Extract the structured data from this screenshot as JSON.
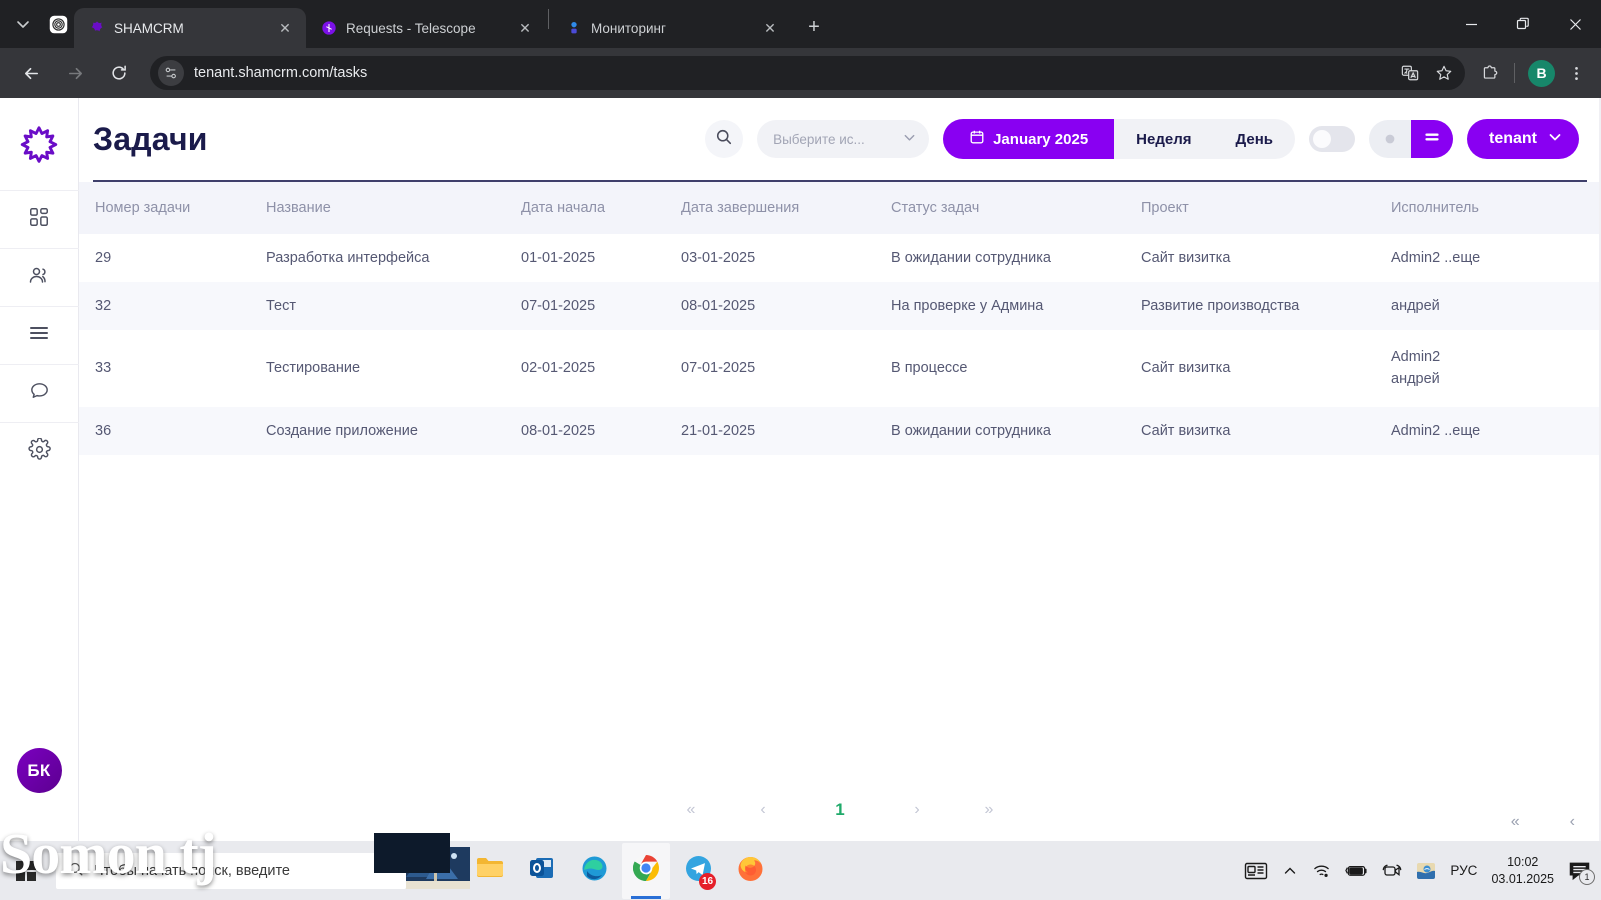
{
  "browser": {
    "tabs": [
      {
        "title": "SHAMCRM",
        "favicon": "shamcrm-icon",
        "active": true
      },
      {
        "title": "Requests - Telescope",
        "favicon": "telescope-icon",
        "active": false
      },
      {
        "title": "Мониторинг",
        "favicon": "monitoring-icon",
        "active": false
      }
    ],
    "new_tab_label": "+",
    "window_controls": {
      "minimize": "−",
      "maximize": "❐",
      "close": "✕"
    },
    "toolbar": {
      "back": "back-arrow",
      "forward": "forward-arrow",
      "reload": "reload",
      "url": "tenant.shamcrm.com/tasks",
      "site_icon": "site-settings-icon",
      "translate": "translate-icon",
      "bookmark": "star-icon",
      "extensions": "extensions-icon",
      "profile_initial": "B",
      "menu": "kebab-menu"
    }
  },
  "app": {
    "sidebar": {
      "logo": "shamcrm-logo",
      "items": [
        {
          "name": "dashboard",
          "icon": "grid-icon"
        },
        {
          "name": "clients",
          "icon": "users-icon"
        },
        {
          "name": "tasks",
          "icon": "menu-lines-icon"
        },
        {
          "name": "chat",
          "icon": "chat-bubble-icon"
        },
        {
          "name": "settings",
          "icon": "gear-icon"
        }
      ],
      "user_initials": "БК"
    },
    "header": {
      "title": "Задачи",
      "search_icon": "search-icon",
      "select_placeholder": "Выберите ис...",
      "select_chevron": "chevron-down-icon",
      "month_label": "January 2025",
      "calendar_icon": "calendar-icon",
      "week_label": "Неделя",
      "day_label": "День",
      "toggle_state": "off",
      "view_icon": "list-view-icon",
      "tenant_label": "tenant",
      "tenant_chevron": "chevron-down-icon",
      "accent_color": "#8900f2",
      "title_color": "#1b1b4b"
    },
    "table": {
      "columns": [
        "Номер задачи",
        "Название",
        "Дата начала",
        "Дата завершения",
        "Статус задач",
        "Проект",
        "Исполнитель"
      ],
      "rows": [
        {
          "number": "29",
          "name": "Разработка интерфейса",
          "start": "01-01-2025",
          "end": "03-01-2025",
          "status": "В ожидании сотрудника",
          "project": "Сайт визитка",
          "assignee": "Admin2 ..еще"
        },
        {
          "number": "32",
          "name": "Тест",
          "start": "07-01-2025",
          "end": "08-01-2025",
          "status": "На проверке у Админа",
          "project": "Развитие производства",
          "assignee": "андрей"
        },
        {
          "number": "33",
          "name": "Тестирование",
          "start": "02-01-2025",
          "end": "07-01-2025",
          "status": "В процессе",
          "project": "Сайт визитка",
          "assignee": "Admin2\nандрей"
        },
        {
          "number": "36",
          "name": "Создание приложение",
          "start": "08-01-2025",
          "end": "21-01-2025",
          "status": "В ожидании сотрудника",
          "project": "Сайт визитка",
          "assignee": "Admin2 ..еще"
        }
      ]
    },
    "pagination": {
      "first": "«",
      "prev": "‹",
      "current": "1",
      "next": "›",
      "last": "»",
      "current_color": "#1faa6a"
    }
  },
  "taskbar": {
    "start_icon": "windows-start-icon",
    "search_placeholder": "Чтобы начать поиск, введите",
    "search_icon": "search-icon",
    "apps": [
      {
        "name": "weather-widget",
        "icon": "weather-icon"
      },
      {
        "name": "file-explorer",
        "icon": "folder-icon"
      },
      {
        "name": "outlook",
        "icon": "outlook-icon"
      },
      {
        "name": "edge",
        "icon": "edge-icon"
      },
      {
        "name": "chrome",
        "icon": "chrome-icon",
        "active": true
      },
      {
        "name": "telegram",
        "icon": "telegram-icon",
        "badge": "16"
      },
      {
        "name": "firefox",
        "icon": "firefox-icon"
      }
    ],
    "tray": {
      "news_icon": "news-icon",
      "chevron_up": "chevron-up-icon",
      "wifi_icon": "wifi-icon",
      "battery_icon": "battery-icon",
      "camera_icon": "camera-icon",
      "app_icon": "tray-app-icon",
      "language": "РУС",
      "time": "10:02",
      "date": "03.01.2025",
      "notification_count": "1"
    }
  },
  "watermark": {
    "text": "Somon tj"
  }
}
